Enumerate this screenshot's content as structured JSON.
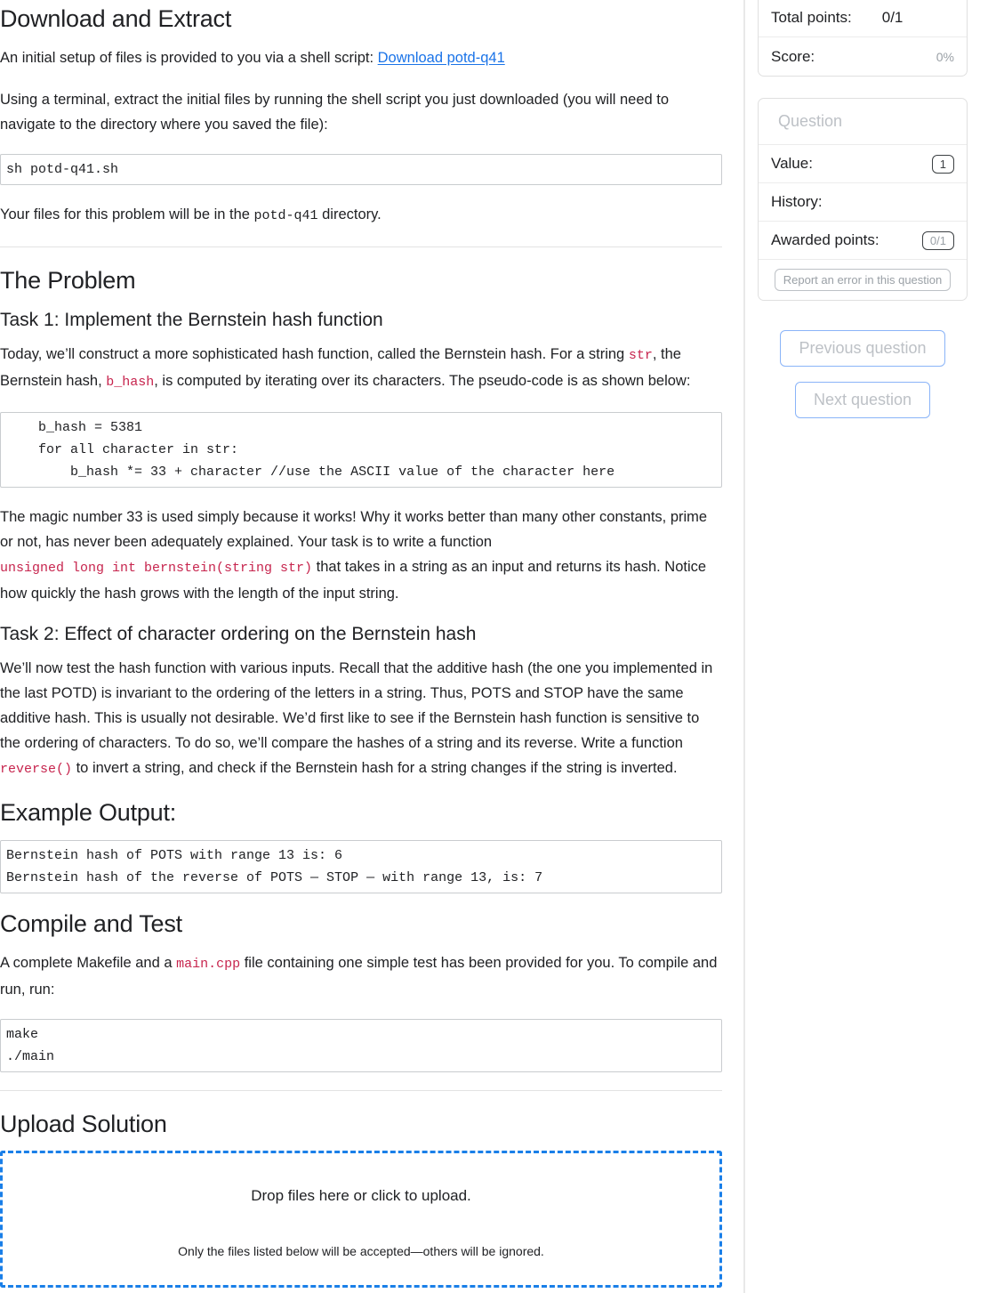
{
  "main": {
    "download_section": {
      "heading": "Download and Extract",
      "intro_prefix": "An initial setup of files is provided to you via a shell script: ",
      "download_link": "Download potd-q41",
      "terminal_paragraph": "Using a terminal, extract the initial files by running the shell script you just downloaded (you will need to navigate to the directory where you saved the file):",
      "shell_code": "sh potd-q41.sh",
      "files_prefix": "Your files for this problem will be in the ",
      "files_dir": "potd-q41",
      "files_suffix": " directory."
    },
    "problem_section": {
      "heading": "The Problem",
      "task1_heading": "Task 1: Implement the Bernstein hash function",
      "task1_p1_a": "Today, we’ll construct a more sophisticated hash function, called the Bernstein hash. For a string ",
      "task1_p1_code1": "str",
      "task1_p1_b": ", the Bernstein hash, ",
      "task1_p1_code2": "b_hash",
      "task1_p1_c": ", is computed by iterating over its characters. The pseudo-code is as shown below:",
      "pseudocode": "    b_hash = 5381\n    for all character in str:\n        b_hash *= 33 + character //use the ASCII value of the character here",
      "task1_p2_a": "The magic number 33 is used simply because it works! Why it works better than many other constants, prime or not, has never been adequately explained. Your task is to write a function ",
      "task1_p2_code": "unsigned long int bernstein(string str)",
      "task1_p2_b": " that takes in a string as an input and returns its hash. Notice how quickly the hash grows with the length of the input string.",
      "task2_heading": "Task 2: Effect of character ordering on the Bernstein hash",
      "task2_p1_a": "We’ll now test the hash function with various inputs. Recall that the additive hash (the one you implemented in the last POTD) is invariant to the ordering of the letters in a string. Thus, POTS and STOP have the same additive hash. This is usually not desirable. We’d first like to see if the Bernstein hash function is sensitive to the ordering of characters. To do so, we’ll compare the hashes of a string and its reverse. Write a function ",
      "task2_p1_code": "reverse()",
      "task2_p1_b": " to invert a string, and check if the Bernstein hash for a string changes if the string is inverted."
    },
    "example_section": {
      "heading": "Example Output:",
      "output": "Bernstein hash of POTS with range 13 is: 6\nBernstein hash of the reverse of POTS — STOP — with range 13, is: 7"
    },
    "compile_section": {
      "heading": "Compile and Test",
      "p_a": "A complete Makefile and a ",
      "p_code": "main.cpp",
      "p_b": " file containing one simple test has been provided for you. To compile and run, run:",
      "code": "make\n./main"
    },
    "upload_section": {
      "heading": "Upload Solution",
      "drop_main": "Drop files here or click to upload.",
      "drop_sub": "Only the files listed below will be accepted—others will be ignored."
    }
  },
  "sidebar": {
    "score_panel": {
      "total_points_label": "Total points:",
      "total_points_value": "0/1",
      "score_label": "Score:",
      "score_value": "0%"
    },
    "question_panel": {
      "title": "Question",
      "value_label": "Value:",
      "value_badge": "1",
      "history_label": "History:",
      "history_value": "",
      "awarded_label": "Awarded points:",
      "awarded_badge": "0/1",
      "report_button": "Report an error in this question"
    },
    "nav": {
      "previous": "Previous question",
      "next": "Next question"
    }
  },
  "colors": {
    "link": "#1a73e8",
    "inline_code": "#c7254e",
    "dropzone_border": "#1a7fe8",
    "nav_button_border": "#8ab4f8",
    "muted_text": "#9aa0a6"
  }
}
